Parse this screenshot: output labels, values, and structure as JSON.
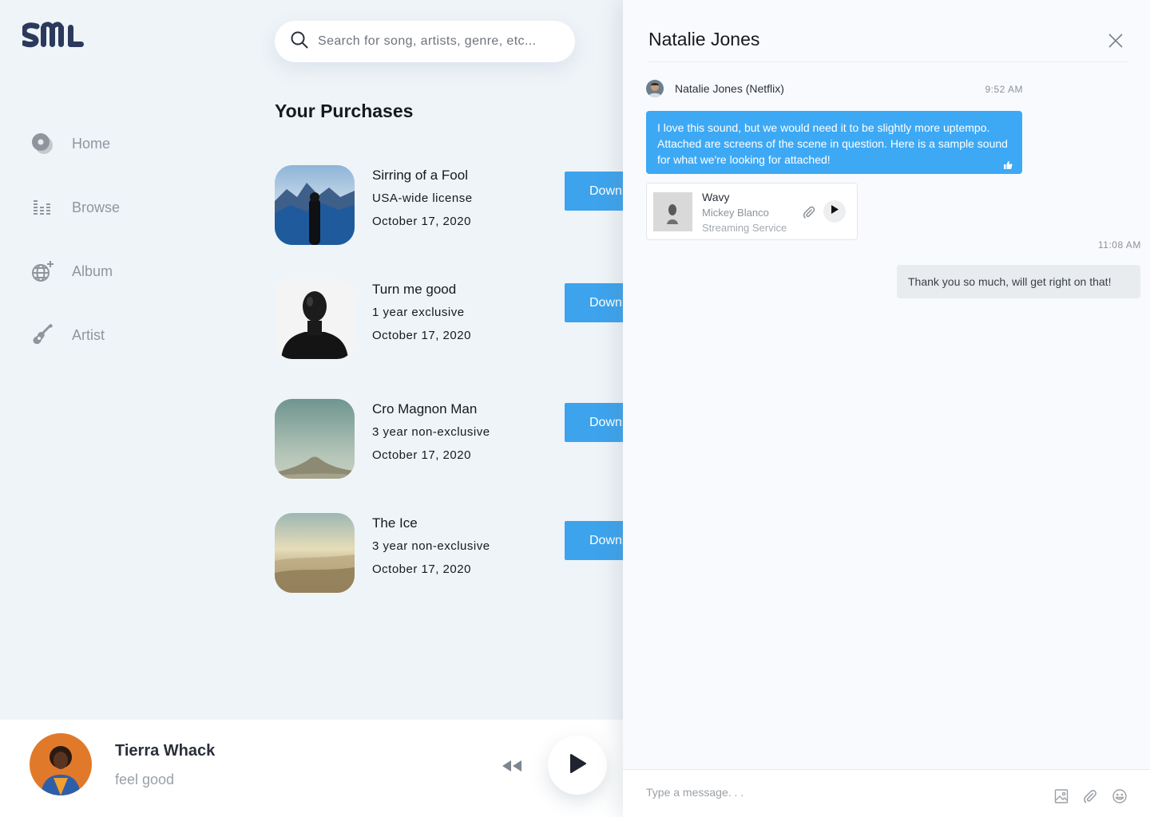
{
  "app": {
    "logo_text": "SML"
  },
  "search": {
    "placeholder": "Search for song, artists, genre, etc..."
  },
  "nav": {
    "items": [
      {
        "label": "Home",
        "icon": "disc-icon"
      },
      {
        "label": "Browse",
        "icon": "equalizer-icon"
      },
      {
        "label": "Album",
        "icon": "globe-plus-icon"
      },
      {
        "label": "Artist",
        "icon": "guitar-icon"
      }
    ]
  },
  "purchases": {
    "title": "Your Purchases",
    "download_label": "Download",
    "items": [
      {
        "title": "Sirring of a Fool",
        "license": "USA-wide license",
        "date": "October 17, 2020"
      },
      {
        "title": "Turn me good",
        "license": "1 year exclusive",
        "date": "October 17, 2020"
      },
      {
        "title": "Cro Magnon Man",
        "license": "3 year non-exclusive",
        "date": "October 17, 2020"
      },
      {
        "title": "The Ice",
        "license": "3 year non-exclusive",
        "date": "October 17, 2020"
      }
    ]
  },
  "player": {
    "artist": "Tierra Whack",
    "track": "feel good"
  },
  "chat": {
    "title": "Natalie Jones",
    "messages": [
      {
        "sender": "Natalie Jones (Netflix)",
        "time": "9:52 AM",
        "text": "I love this sound, but we would need it to be slightly more uptempo. Attached are screens of the scene in question. Here is a sample sound for what we're looking for attached!"
      }
    ],
    "attachment": {
      "title": "Wavy",
      "artist": "Mickey Blanco",
      "service": "Streaming Service"
    },
    "reply": {
      "time": "11:08 AM",
      "text": "Thank you so much, will get right on that!"
    },
    "composer": {
      "placeholder": "Type a message. . ."
    }
  },
  "colors": {
    "accent": "#3da3ec",
    "bubble": "#3da9f5",
    "logo": "#2b3a5c",
    "background": "#eff4f8"
  }
}
